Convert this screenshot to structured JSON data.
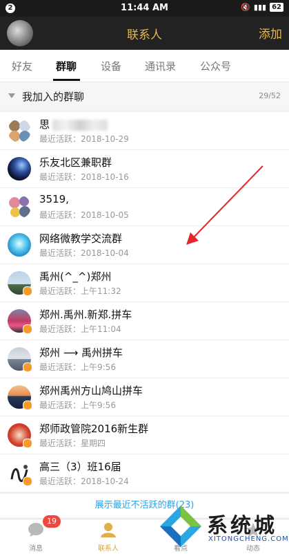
{
  "status_bar": {
    "notif_badge": "2",
    "time": "11:44 AM",
    "battery": "62"
  },
  "header": {
    "title": "联系人",
    "add_label": "添加"
  },
  "tabs": [
    {
      "label": "好友",
      "active": false
    },
    {
      "label": "群聊",
      "active": true
    },
    {
      "label": "设备",
      "active": false
    },
    {
      "label": "通讯录",
      "active": false
    },
    {
      "label": "公众号",
      "active": false
    }
  ],
  "section": {
    "title": "我加入的群聊",
    "count": "29/52"
  },
  "groups": [
    {
      "name": "思",
      "subtitle": "最近活跃：2018-10-29"
    },
    {
      "name": "乐友北区兼职群",
      "subtitle": "最近活跃：2018-10-16"
    },
    {
      "name": "3519,",
      "subtitle": "最近活跃：2018-10-05"
    },
    {
      "name": "网络微教学交流群",
      "subtitle": "最近活跃：2018-10-04"
    },
    {
      "name": "禹州(^_^)郑州",
      "subtitle": "最近活跃：上午11:32"
    },
    {
      "name": "郑州.禹州.新郑.拼车",
      "subtitle": "最近活跃：上午11:04"
    },
    {
      "name": "郑州 ⟶ 禹州拼车",
      "subtitle": "最近活跃：上午9:56"
    },
    {
      "name": "郑州禹州方山鸠山拼车",
      "subtitle": "最近活跃：上午9:56"
    },
    {
      "name": "郑师政管院2016新生群",
      "subtitle": "最近活跃：星期四"
    },
    {
      "name": "高三（3）班16届",
      "subtitle": "最近活跃：2018-10-24"
    }
  ],
  "show_inactive": "展示最近不活跃的群(23)",
  "bottom_nav": [
    {
      "label": "消息",
      "badge": "19"
    },
    {
      "label": "联系人"
    },
    {
      "label": "看点"
    },
    {
      "label": "动态"
    }
  ],
  "watermark": {
    "cn": "系统城",
    "en": "XITONGCHENG.COM"
  },
  "colors": {
    "accent_gold": "#e9b74a",
    "link_blue": "#27a3e6",
    "badge_red": "#f0483e",
    "annotation_red": "#e3262b"
  }
}
